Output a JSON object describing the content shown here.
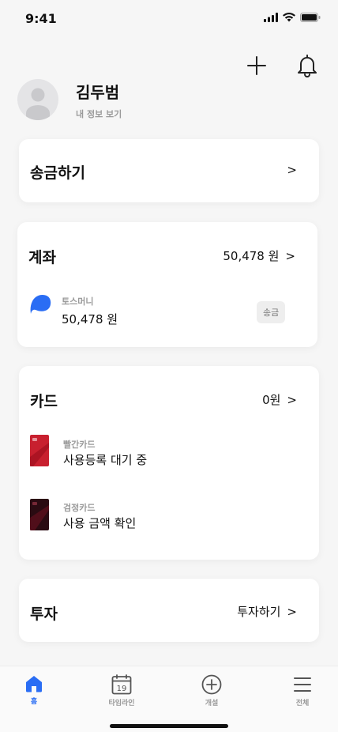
{
  "status": {
    "time": "9:41"
  },
  "profile": {
    "name": "김두범",
    "subtitle": "내 정보 보기"
  },
  "transfer": {
    "title": "송금하기",
    "chevron": ">"
  },
  "accounts": {
    "title": "계좌",
    "total": "50,478 원",
    "chevron": ">",
    "items": [
      {
        "label": "토스머니",
        "amount": "50,478 원",
        "action": "송금",
        "icon": "toss-money-icon"
      }
    ]
  },
  "cards": {
    "title": "카드",
    "total": "0원",
    "chevron": ">",
    "items": [
      {
        "label": "빨간카드",
        "status": "사용등록 대기 중",
        "color": "#c8202f"
      },
      {
        "label": "검정카드",
        "status": "사용 금액 확인",
        "color": "#2a0b12"
      }
    ]
  },
  "invest": {
    "title": "투자",
    "action": "투자하기",
    "chevron": ">"
  },
  "tabbar": {
    "items": [
      {
        "label": "홈",
        "icon": "home-icon",
        "active": true
      },
      {
        "label": "타임라인",
        "icon": "calendar-icon",
        "badge": "19"
      },
      {
        "label": "개설",
        "icon": "plus-circle-icon"
      },
      {
        "label": "전체",
        "icon": "menu-icon"
      }
    ]
  },
  "colors": {
    "accent": "#2a6df4",
    "background": "#f6f6f6"
  }
}
